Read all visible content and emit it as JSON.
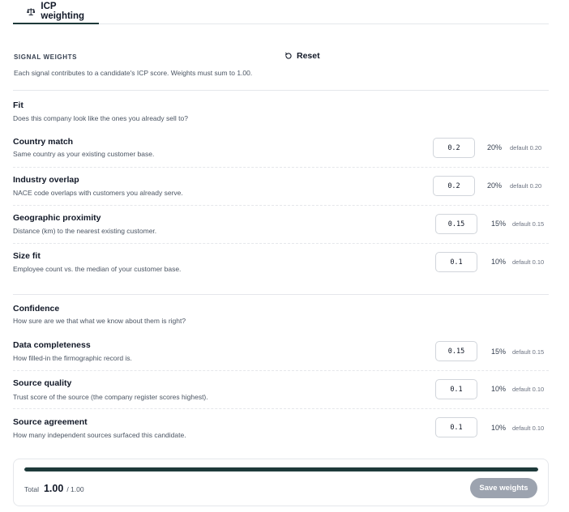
{
  "tab": {
    "label": "ICP weighting"
  },
  "section": {
    "title": "SIGNAL WEIGHTS",
    "description": "Each signal contributes to a candidate's ICP score. Weights must sum to 1.00.",
    "reset_label": "Reset"
  },
  "groups": [
    {
      "title": "Fit",
      "description": "Does this company look like the ones you already sell to?",
      "signals": [
        {
          "title": "Country match",
          "description": "Same country as your existing customer base.",
          "weight": "0.2",
          "percent": "20%",
          "default": "default 0.20"
        },
        {
          "title": "Industry overlap",
          "description": "NACE code overlaps with customers you already serve.",
          "weight": "0.2",
          "percent": "20%",
          "default": "default 0.20"
        },
        {
          "title": "Geographic proximity",
          "description": "Distance (km) to the nearest existing customer.",
          "weight": "0.15",
          "percent": "15%",
          "default": "default 0.15"
        },
        {
          "title": "Size fit",
          "description": "Employee count vs. the median of your customer base.",
          "weight": "0.1",
          "percent": "10%",
          "default": "default 0.10"
        }
      ]
    },
    {
      "title": "Confidence",
      "description": "How sure are we that what we know about them is right?",
      "signals": [
        {
          "title": "Data completeness",
          "description": "How filled-in the firmographic record is.",
          "weight": "0.15",
          "percent": "15%",
          "default": "default 0.15"
        },
        {
          "title": "Source quality",
          "description": "Trust score of the source (the company register scores highest).",
          "weight": "0.1",
          "percent": "10%",
          "default": "default 0.10"
        },
        {
          "title": "Source agreement",
          "description": "How many independent sources surfaced this candidate.",
          "weight": "0.1",
          "percent": "10%",
          "default": "default 0.10"
        }
      ]
    }
  ],
  "footer": {
    "total_label": "Total",
    "total_value": "1.00",
    "total_target": "/ 1.00",
    "progress_fraction": 1.0,
    "save_label": "Save weights"
  },
  "colors": {
    "accent": "#1e3a3a",
    "save_disabled": "#9ca3af"
  },
  "icons": {
    "tab": "balance-scale-icon",
    "reset": "refresh-icon"
  }
}
